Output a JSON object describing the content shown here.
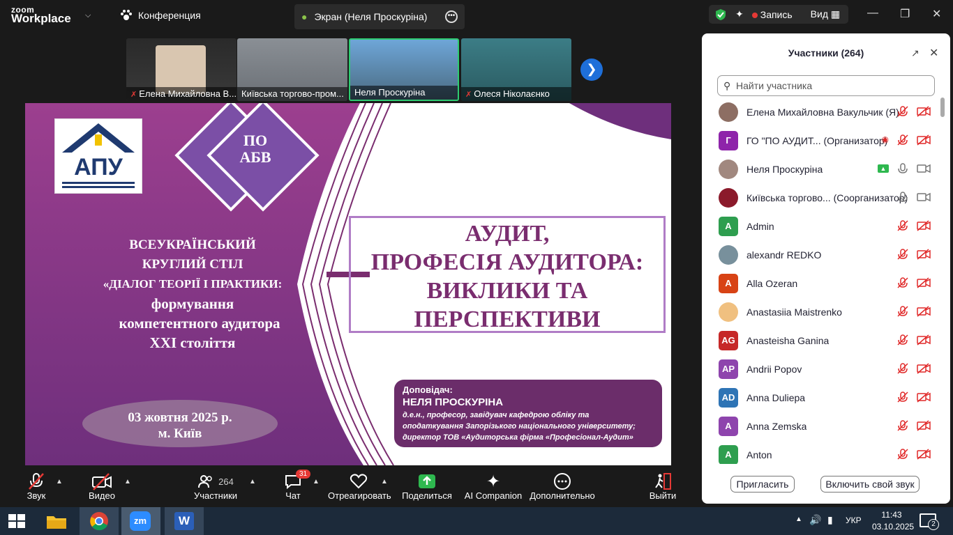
{
  "app": {
    "brand_top": "zoom",
    "brand_bottom": "Workplace"
  },
  "topbar": {
    "conference_label": "Конференция",
    "screen_tab_label": "Экран (Неля Проскуріна)",
    "record_label": "Запись",
    "view_label": "Вид"
  },
  "thumbnails": [
    {
      "name": "Елена Михайловна В...",
      "muted": true
    },
    {
      "name": "Київська торгово-пром...",
      "muted": false
    },
    {
      "name": "Неля Проскуріна",
      "muted": false
    },
    {
      "name": "Олеся Ніколаєнко",
      "muted": true
    }
  ],
  "slide": {
    "logo_text": "АПУ",
    "badge_top": "ПО",
    "badge_bottom": "АБВ",
    "left_lines": [
      "ВСЕУКРАЇНСЬКИЙ",
      "КРУГЛИЙ СТІЛ",
      "«ДІАЛОГ ТЕОРІЇ І ПРАКТИКИ:",
      "формування",
      "компетентного аудитора",
      "XXI століття"
    ],
    "date": "03 жовтня 2025 р.",
    "city": "м. Київ",
    "title_lines": [
      "АУДИТ,",
      "ПРОФЕСІЯ АУДИТОРА:",
      "ВИКЛИКИ ТА",
      "ПЕРСПЕКТИВИ"
    ],
    "speaker_label": "Доповідач:",
    "speaker_name": "НЕЛЯ ПРОСКУРІНА",
    "speaker_desc": [
      "д.е.н., професор, завідувач кафедрою обліку та",
      "оподаткування Запорізького національного університету;",
      "директор ТОВ «Аудиторська фірма «Професіонал-Аудит»"
    ]
  },
  "toolbar": {
    "audio": "Звук",
    "video": "Видео",
    "participants": "Участники",
    "participants_count": "264",
    "chat": "Чат",
    "chat_badge": "31",
    "react": "Отреагировать",
    "share": "Поделиться",
    "ai": "AI Companion",
    "more": "Дополнительно",
    "leave": "Выйти"
  },
  "panel": {
    "title": "Участники (264)",
    "search_placeholder": "Найти участника",
    "participants": [
      {
        "name": "Елена Михайловна Вакульчик (Я)",
        "initials": "",
        "color": "#8d6e63",
        "photo": true,
        "mic": "muted",
        "video": "off"
      },
      {
        "name": "ГО \"ПО АУДИТ...  (Организатор)",
        "initials": "Г",
        "color": "#8e24aa",
        "photo": false,
        "mic": "muted",
        "video": "off",
        "record": true
      },
      {
        "name": "Неля Проскуріна",
        "initials": "",
        "color": "#a1887f",
        "photo": true,
        "mic": "on",
        "video": "on",
        "share": true
      },
      {
        "name": "Київська торгово...  (Соорганизатор)",
        "initials": "",
        "color": "#8b1a2b",
        "photo": true,
        "mic": "on",
        "video": "on"
      },
      {
        "name": "Admin",
        "initials": "A",
        "color": "#2e9e4f",
        "photo": false,
        "mic": "muted",
        "video": "off"
      },
      {
        "name": "alexandr REDKO",
        "initials": "",
        "color": "#78909c",
        "photo": true,
        "mic": "muted",
        "video": "off"
      },
      {
        "name": "Alla Ozeran",
        "initials": "A",
        "color": "#d84315",
        "photo": false,
        "mic": "muted",
        "video": "off"
      },
      {
        "name": "Anastasiia Maistrenko",
        "initials": "",
        "color": "#f0c080",
        "photo": true,
        "mic": "muted",
        "video": "off"
      },
      {
        "name": "Anasteisha Ganina",
        "initials": "AG",
        "color": "#c62828",
        "photo": false,
        "mic": "muted",
        "video": "off"
      },
      {
        "name": "Andrii Popov",
        "initials": "AP",
        "color": "#8e44ad",
        "photo": false,
        "mic": "muted",
        "video": "off"
      },
      {
        "name": "Anna Duliepa",
        "initials": "AD",
        "color": "#2e74b5",
        "photo": false,
        "mic": "muted",
        "video": "off"
      },
      {
        "name": "Anna Zemska",
        "initials": "A",
        "color": "#8e44ad",
        "photo": false,
        "mic": "muted",
        "video": "off"
      },
      {
        "name": "Anton",
        "initials": "A",
        "color": "#2e9e4f",
        "photo": false,
        "mic": "muted",
        "video": "off"
      }
    ],
    "invite_button": "Пригласить",
    "unmute_button": "Включить свой звук"
  },
  "taskbar": {
    "lang": "УКР",
    "time": "11:43",
    "date": "03.10.2025",
    "notif_count": "2"
  }
}
